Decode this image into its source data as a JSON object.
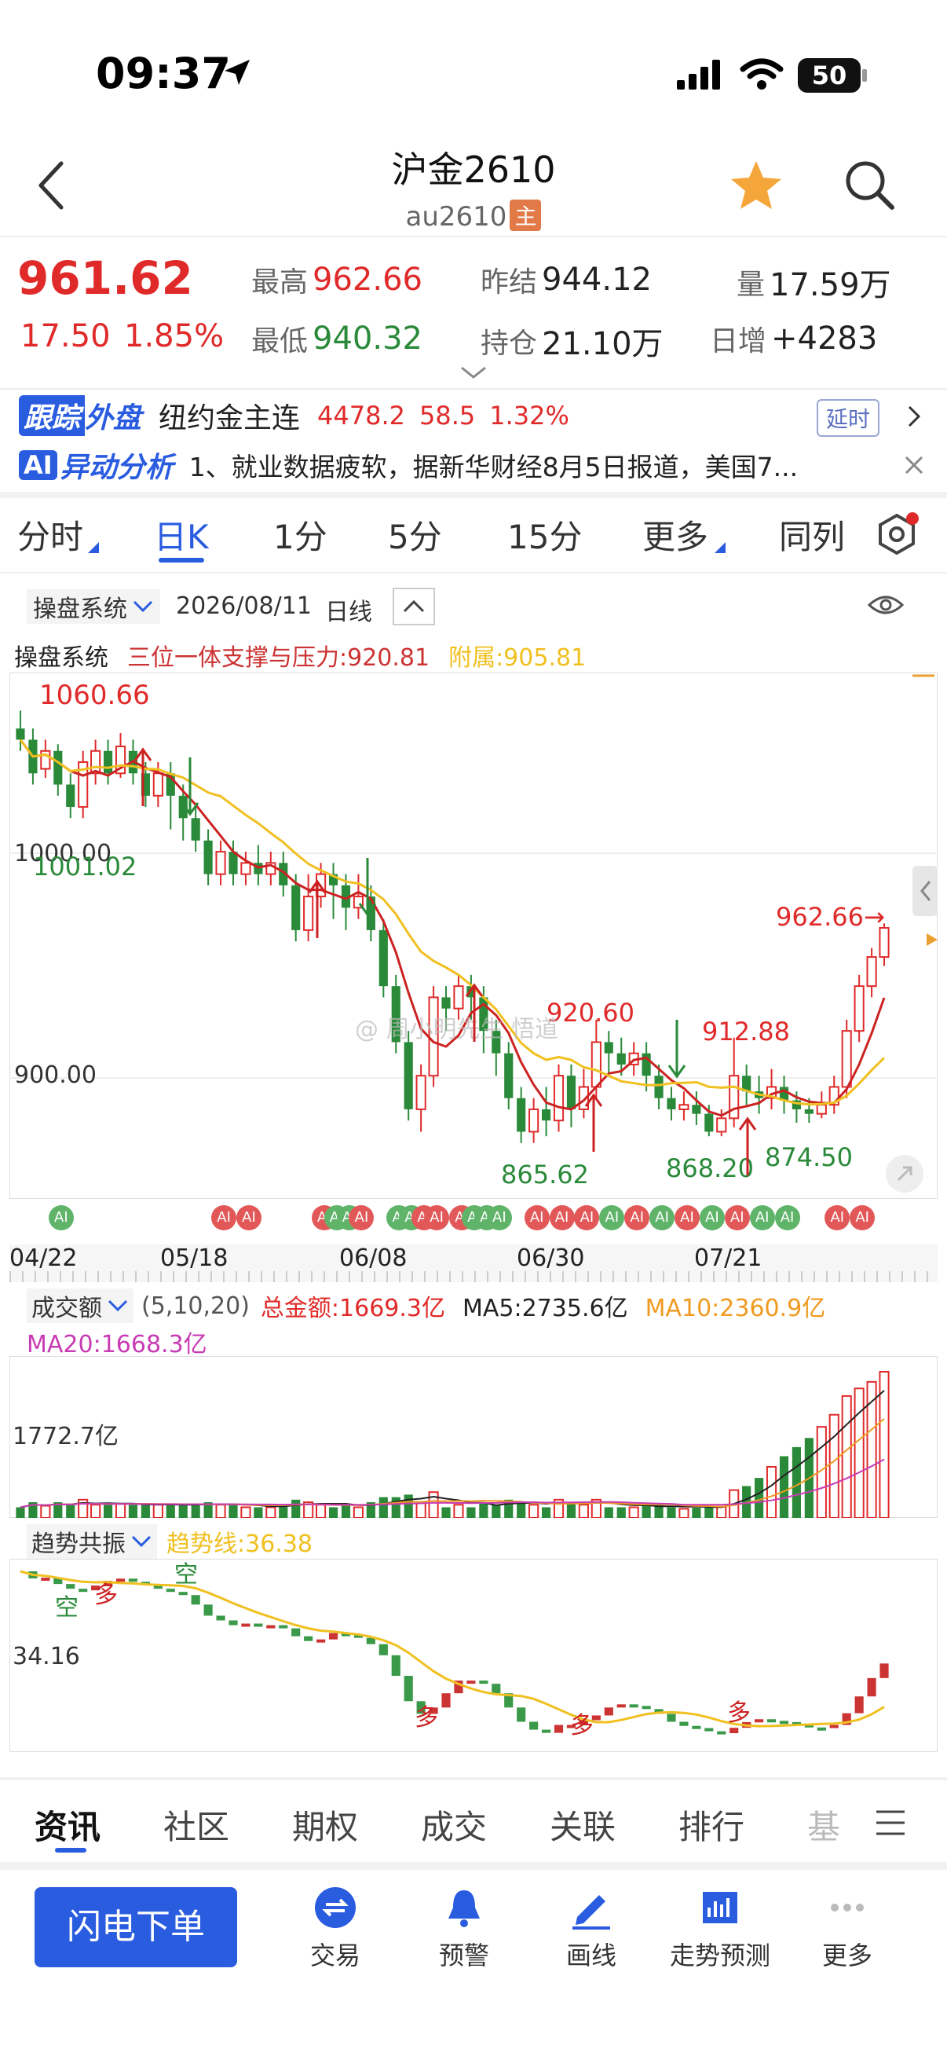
{
  "status_bar": {
    "time": "09:37",
    "battery": "50"
  },
  "header": {
    "title": "沪金2610",
    "code": "au2610",
    "main_badge": "主"
  },
  "quote": {
    "price": "961.62",
    "change": "17.50",
    "change_pct": "1.85%",
    "high_label": "最高",
    "high": "962.66",
    "low_label": "最低",
    "low": "940.32",
    "prev_settle_label": "昨结",
    "prev_settle": "944.12",
    "open_interest_label": "持仓",
    "open_interest": "21.10万",
    "volume_label": "量",
    "volume": "17.59万",
    "daily_inc_label": "日增",
    "daily_inc": "+4283"
  },
  "outer_market": {
    "badge_a": "跟踪",
    "badge_b": "外盘",
    "name": "纽约金主连",
    "price": "4478.2",
    "change": "58.5",
    "change_pct": "1.32%",
    "delay": "延时"
  },
  "ai_analysis": {
    "badge": "AI",
    "title": "异动分析",
    "text": "1、就业数据疲软，据新华财经8月5日报道，美国7..."
  },
  "period_tabs": [
    "分时",
    "日K",
    "1分",
    "5分",
    "15分",
    "更多",
    "同列"
  ],
  "chart_toolbar": {
    "system": "操盘系统",
    "date": "2026/08/11",
    "period": "日线"
  },
  "indicator": {
    "name": "操盘系统",
    "support": "三位一体支撑与压力:920.81",
    "attach": "附属:905.81"
  },
  "price_axis": [
    "1000.00",
    "900.00"
  ],
  "annotations": {
    "max": "1060.66",
    "low1": "1001.02",
    "peak1": "920.60",
    "low2": "865.62",
    "peak2": "912.88",
    "low3": "868.20",
    "low4": "874.50",
    "last_high": "962.66→"
  },
  "ai_marker": "AI",
  "date_axis": [
    "04/22",
    "05/18",
    "06/08",
    "06/30",
    "07/21"
  ],
  "watermark": "@ 周小明先生 悟道",
  "volume_panel": {
    "name": "成交额",
    "params": "(5,10,20)",
    "total": "总金额:1669.3亿",
    "ma5": "MA5:2735.6亿",
    "ma10": "MA10:2360.9亿",
    "ma20": "MA20:1668.3亿",
    "axis": "1772.7亿"
  },
  "trend_panel": {
    "name": "趋势共振",
    "line": "趋势线:36.38",
    "axis": "34.16",
    "kong": "空",
    "duo": "多"
  },
  "info_tabs": [
    "资讯",
    "社区",
    "期权",
    "成交",
    "关联",
    "排行",
    "基"
  ],
  "bottom_nav": {
    "order_button": "闪电下单",
    "items": [
      "交易",
      "预警",
      "画线",
      "走势预测",
      "更多"
    ]
  },
  "colors": {
    "up": "#e02a2a",
    "down": "#2a8a3a",
    "accent": "#2a5ce0",
    "ma_yellow": "#f0c020"
  },
  "chart_data": {
    "type": "candlestick",
    "dates_shown": [
      "04/22",
      "05/18",
      "06/08",
      "06/30",
      "07/21"
    ],
    "price_ylim": [
      840,
      1075
    ],
    "candles": [
      [
        1050,
        1045,
        1058,
        1040
      ],
      [
        1045,
        1030,
        1050,
        1025
      ],
      [
        1032,
        1040,
        1045,
        1028
      ],
      [
        1040,
        1025,
        1043,
        1020
      ],
      [
        1025,
        1015,
        1030,
        1010
      ],
      [
        1015,
        1035,
        1040,
        1010
      ],
      [
        1030,
        1040,
        1045,
        1025
      ],
      [
        1040,
        1030,
        1045,
        1025
      ],
      [
        1030,
        1042,
        1048,
        1028
      ],
      [
        1040,
        1030,
        1045,
        1025
      ],
      [
        1030,
        1020,
        1035,
        1015
      ],
      [
        1020,
        1030,
        1035,
        1015
      ],
      [
        1030,
        1020,
        1035,
        1005
      ],
      [
        1020,
        1010,
        1025,
        1000
      ],
      [
        1010,
        1000,
        1015,
        995
      ],
      [
        1000,
        985,
        1005,
        980
      ],
      [
        985,
        995,
        1000,
        980
      ],
      [
        995,
        985,
        1000,
        980
      ],
      [
        985,
        990,
        995,
        980
      ],
      [
        990,
        985,
        998,
        980
      ],
      [
        985,
        990,
        995,
        980
      ],
      [
        990,
        980,
        995,
        975
      ],
      [
        980,
        960,
        985,
        955
      ],
      [
        960,
        975,
        985,
        955
      ],
      [
        975,
        985,
        990,
        970
      ],
      [
        985,
        980,
        990,
        965
      ],
      [
        980,
        970,
        985,
        960
      ],
      [
        970,
        975,
        985,
        965
      ],
      [
        975,
        960,
        980,
        955
      ],
      [
        960,
        935,
        965,
        930
      ],
      [
        935,
        910,
        940,
        905
      ],
      [
        910,
        880,
        915,
        875
      ],
      [
        880,
        895,
        900,
        870
      ],
      [
        895,
        930,
        935,
        890
      ],
      [
        930,
        925,
        935,
        915
      ],
      [
        925,
        935,
        940,
        920
      ],
      [
        935,
        930,
        940,
        920
      ],
      [
        930,
        915,
        935,
        905
      ],
      [
        915,
        905,
        920,
        895
      ],
      [
        905,
        885,
        910,
        880
      ],
      [
        885,
        870,
        890,
        865
      ],
      [
        870,
        880,
        885,
        865
      ],
      [
        880,
        875,
        890,
        868
      ],
      [
        875,
        895,
        900,
        870
      ],
      [
        895,
        880,
        900,
        872
      ],
      [
        880,
        890,
        898,
        876
      ],
      [
        890,
        910,
        920,
        885
      ],
      [
        910,
        905,
        915,
        895
      ],
      [
        905,
        900,
        912,
        895
      ],
      [
        900,
        905,
        910,
        895
      ],
      [
        905,
        895,
        910,
        888
      ],
      [
        895,
        885,
        900,
        880
      ],
      [
        885,
        880,
        890,
        875
      ],
      [
        880,
        882,
        888,
        875
      ],
      [
        882,
        878,
        888,
        873
      ],
      [
        878,
        870,
        882,
        868
      ],
      [
        870,
        876,
        880,
        868
      ],
      [
        876,
        895,
        912,
        872
      ],
      [
        895,
        888,
        900,
        882
      ],
      [
        888,
        885,
        895,
        878
      ],
      [
        885,
        890,
        898,
        880
      ],
      [
        890,
        884,
        895,
        878
      ],
      [
        884,
        880,
        888,
        874
      ],
      [
        880,
        878,
        885,
        874
      ],
      [
        878,
        882,
        888,
        876
      ],
      [
        882,
        890,
        895,
        878
      ],
      [
        890,
        915,
        920,
        885
      ],
      [
        915,
        935,
        940,
        910
      ],
      [
        935,
        948,
        952,
        930
      ],
      [
        948,
        961,
        963,
        944
      ]
    ],
    "ma_yellow_trend": "descending then flattening around 880-890, turning up at end",
    "volume_axis": "1772.7亿",
    "trend_axis": "34.16"
  }
}
